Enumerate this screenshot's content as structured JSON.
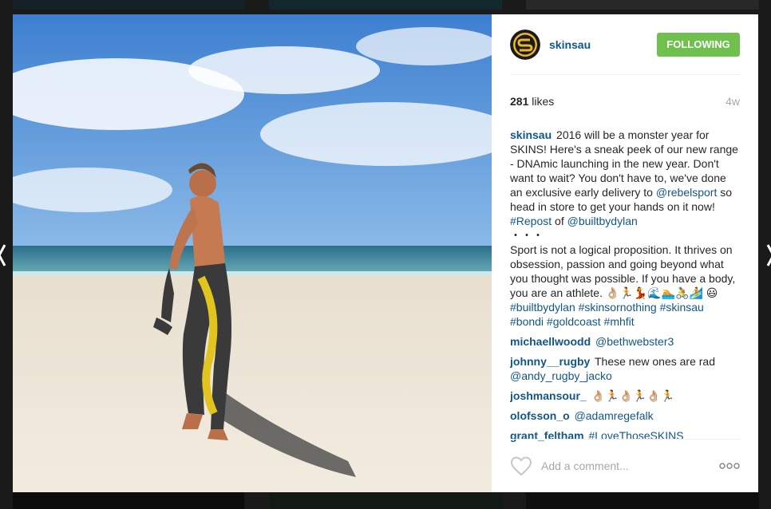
{
  "post": {
    "username": "skinsau",
    "follow_label": "FOLLOWING",
    "likes_count": "281",
    "likes_word": "likes",
    "age": "4w",
    "caption": {
      "user": "skinsau",
      "text1": "2016 will be a monster year for SKINS! Here's a sneak peek of our new range - DNAmic launching in the new year. Don't want to wait? You don't have to, we've done an exclusive early delivery to",
      "mention1": "@rebelsport",
      "text2": "so head in store to get your hands on it now!",
      "tag_repost": "#Repost",
      "text3": "of",
      "mention2": "@builtbydylan",
      "dots": "・・・",
      "text4": "Sport is not a logical proposition. It thrives on obsession, passion and going beyond what you thought was possible. If you have a body, you are an athlete. 👌🏼🏃💃🌊🏊🚴🏄",
      "emoji": "😃",
      "tags": "#builtbydylan #skinsornothing #skinsau #bondi #goldcoast #mhfit"
    },
    "comments": [
      {
        "user": "michaellwoodd",
        "text": "@bethwebster3"
      },
      {
        "user": "johnny__rugby",
        "text": "These new ones are rad",
        "text_link": "@andy_rugby_jacko"
      },
      {
        "user": "joshmansour_",
        "text": "👌🏼🏃👌🏼🏃👌🏼🏃"
      },
      {
        "user": "olofsson_o",
        "text": "@adamregefalk"
      },
      {
        "user": "grant_feltham",
        "text": "#LoveThoseSKINS"
      }
    ],
    "comment_placeholder": "Add a comment..."
  },
  "colors": {
    "link": "#125688",
    "follow_button": "#70c050",
    "muted": "#a5a7aa"
  },
  "icons": {
    "heart": "heart-icon",
    "more": "more-options-icon",
    "prev": "chevron-left-icon",
    "next": "chevron-right-icon"
  }
}
